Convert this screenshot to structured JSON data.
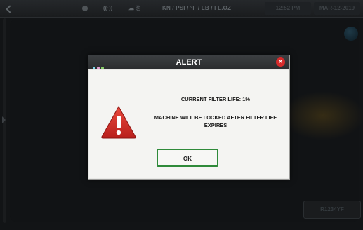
{
  "status_bar": {
    "back_icon": "back-icon",
    "units": "KN / PSI / °F / LB / FL.OZ",
    "time": "12:52 PM",
    "date": "MAR-12-2019"
  },
  "background": {
    "bottom_button_label": "R1234YF"
  },
  "alert": {
    "title": "ALERT",
    "close_symbol": "×",
    "message_filter_life": "CURRENT FILTER LIFE: 1%",
    "message_lock": "MACHINE WILL BE LOCKED AFTER FILTER LIFE EXPIRES",
    "ok_label": "OK",
    "dot_colors": [
      "#7dd3e6",
      "#e6a0d2",
      "#8ad06a"
    ],
    "accent_green": "#2f8a3a",
    "warning_red": "#d12a2a",
    "warning_icon": "warning-icon"
  }
}
